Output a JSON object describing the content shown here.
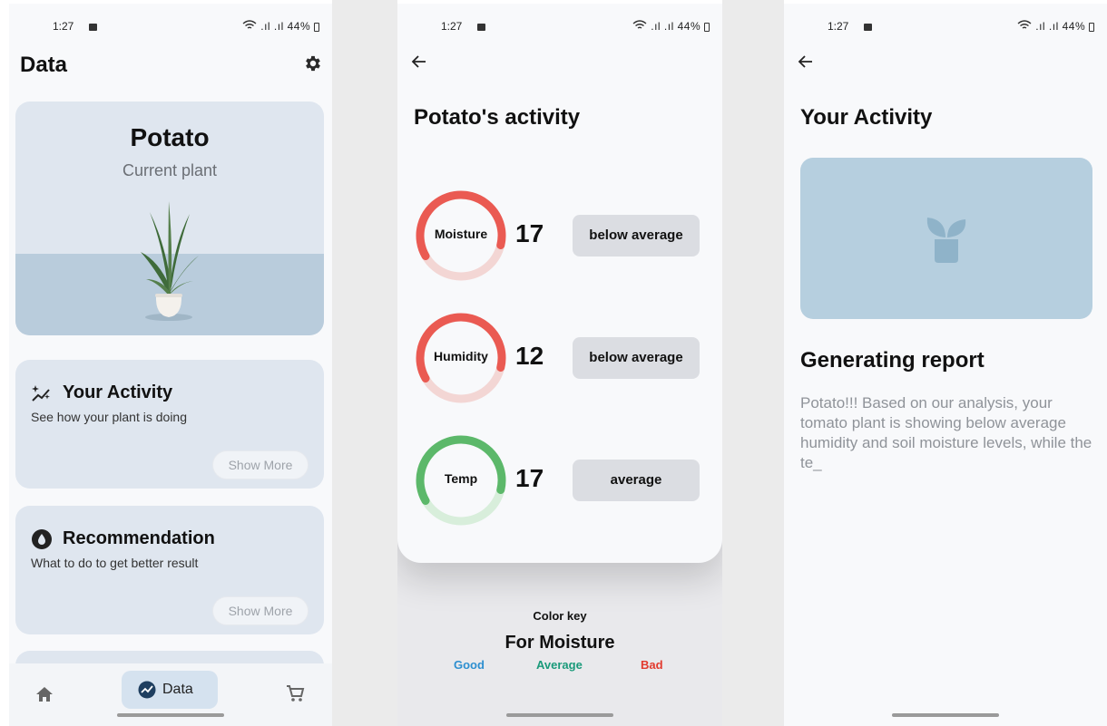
{
  "status_bar": {
    "time": "1:27",
    "battery": "44%",
    "signal_text": ".ıl .ıl"
  },
  "screen_data": {
    "title": "Data",
    "plant_card": {
      "name": "Potato",
      "subtitle": "Current plant"
    },
    "cards": [
      {
        "title": "Your Activity",
        "subtitle": "See how your plant is doing",
        "button": "Show More",
        "icon": "sparkle-trend-icon"
      },
      {
        "title": "Recommendation",
        "subtitle": "What to do to get better result",
        "button": "Show More",
        "icon": "hand-drop-icon"
      }
    ],
    "nav": {
      "active_label": "Data"
    }
  },
  "screen_activity": {
    "title": "Potato's activity",
    "metrics": [
      {
        "label": "Moisture",
        "value": "17",
        "status": "below average",
        "color": "#ea5a52",
        "level": 0.62
      },
      {
        "label": "Humidity",
        "value": "12",
        "status": "below average",
        "color": "#ea5a52",
        "level": 0.62
      },
      {
        "label": "Temp",
        "value": "17",
        "status": "average",
        "color": "#5cb86a",
        "level": 0.62
      }
    ],
    "color_key": {
      "heading": "Color key",
      "subheading": "For Moisture",
      "good": "Good",
      "average": "Average",
      "bad": "Bad",
      "good_color": "#2d8fd0",
      "average_color": "#1a9a7a",
      "bad_color": "#e23a2e"
    }
  },
  "screen_report": {
    "title": "Your Activity",
    "heading": "Generating report",
    "text": "Potato!!! Based on our analysis, your tomato plant is showing below average humidity and soil moisture levels, while the te_"
  }
}
